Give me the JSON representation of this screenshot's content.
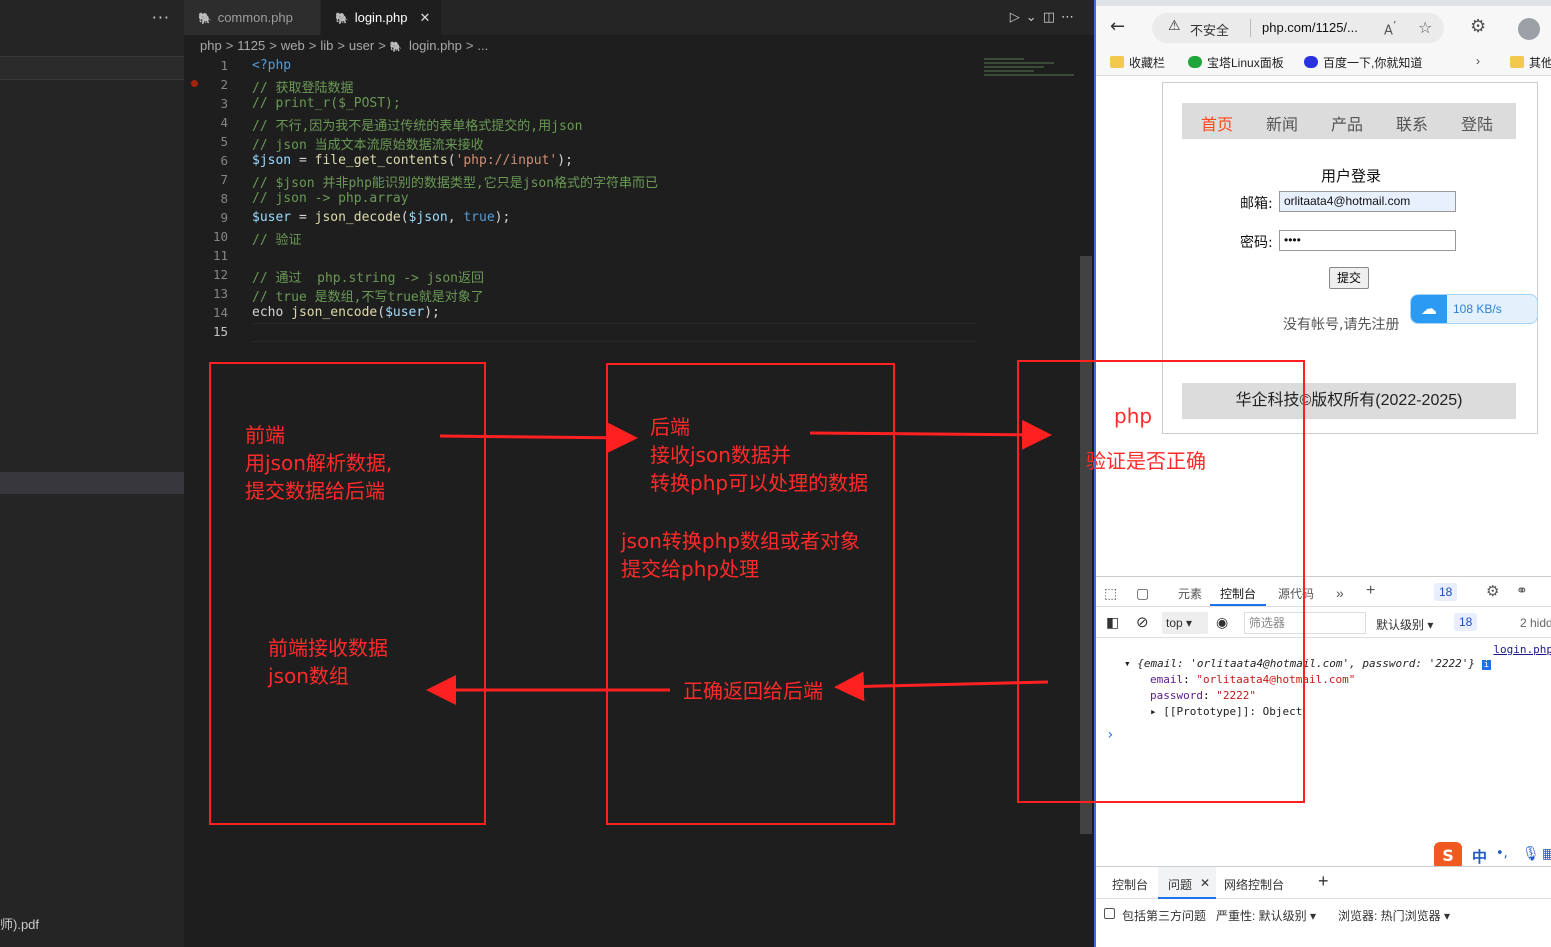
{
  "sidebar": {
    "more_label": "···",
    "file_label": "师).pdf"
  },
  "editor": {
    "tabs": [
      {
        "label": "common.php"
      },
      {
        "label": "login.php",
        "close": "✕"
      }
    ],
    "breadcrumb": [
      "php",
      ">",
      "1125",
      ">",
      "web",
      ">",
      "lib",
      ">",
      "user",
      ">",
      "login.php",
      ">",
      "..."
    ],
    "line_numbers": [
      "1",
      "2",
      "3",
      "4",
      "5",
      "6",
      "7",
      "8",
      "9",
      "10",
      "11",
      "12",
      "13",
      "14",
      "15"
    ],
    "code_lines": [
      "<?php",
      "// 获取登陆数据",
      "// print_r($_POST);",
      "// 不行,因为我不是通过传统的表单格式提交的,用json",
      "// json 当成文本流原始数据流来接收",
      "$json = file_get_contents('php://input');",
      "// $json 并非php能识别的数据类型,它只是json格式的字符串而已",
      "// json -> php.array",
      "$user = json_decode($json, true);",
      "// 验证",
      "",
      "// 通过  php.string -> json返回",
      "// true 是数组,不写true就是对象了",
      "echo json_encode($user);",
      ""
    ]
  },
  "browser": {
    "insecure_label": "不安全",
    "url": "php.com/1125/...",
    "bookmarks": [
      "收藏栏",
      "宝塔Linux面板",
      "百度一下,你就知道",
      "其他"
    ],
    "page": {
      "nav": [
        "首页",
        "新闻",
        "产品",
        "联系",
        "登陆"
      ],
      "form_title": "用户登录",
      "email_label": "邮箱:",
      "email_value": "orlitaata4@hotmail.com",
      "password_label": "密码:",
      "password_value": "••••",
      "submit_label": "提交",
      "register_text": "没有帐号,请先注册",
      "footer": "华企科技©版权所有(2022-2025)"
    },
    "speed_widget": "108 KB/s"
  },
  "devtools": {
    "tabs": [
      "元素",
      "控制台",
      "源代码"
    ],
    "badge_count": "18",
    "context": "top",
    "filter_placeholder": "筛选器",
    "level": "默认级别",
    "hidden": "2 hidd",
    "source_link": "login.php",
    "object_summary": "{email: 'orlitaata4@hotmail.com', password: '2222'}",
    "props": [
      {
        "key": "email",
        "value": "\"orlitaata4@hotmail.com\""
      },
      {
        "key": "password",
        "value": "\"2222\""
      }
    ],
    "prototype": "[[Prototype]]: Object",
    "drawer_tabs": [
      "控制台",
      "问题",
      "网络控制台"
    ],
    "issues_filter": {
      "third_party": "包括第三方问题",
      "severity": "严重性: 默认级别",
      "browser": "浏览器: 热门浏览器"
    },
    "ime": {
      "label": "中",
      "punct": "•,"
    }
  },
  "annotations": {
    "frontend": [
      "前端",
      "用json解析数据,",
      "提交数据给后端"
    ],
    "backend": [
      "后端",
      "接收json数据并",
      "转换php可以处理的数据"
    ],
    "backend_convert": [
      "json转换php数组或者对象",
      "提交给php处理"
    ],
    "php_label": "php",
    "php_verify": "验证是否正确",
    "front_receive": [
      "前端接收数据",
      "json数组"
    ],
    "return_label": "正确返回给后端"
  },
  "colors": {
    "annotation": "#ff2020",
    "vscode_bg": "#1e1e1e",
    "link_blue": "#1a73e8"
  }
}
